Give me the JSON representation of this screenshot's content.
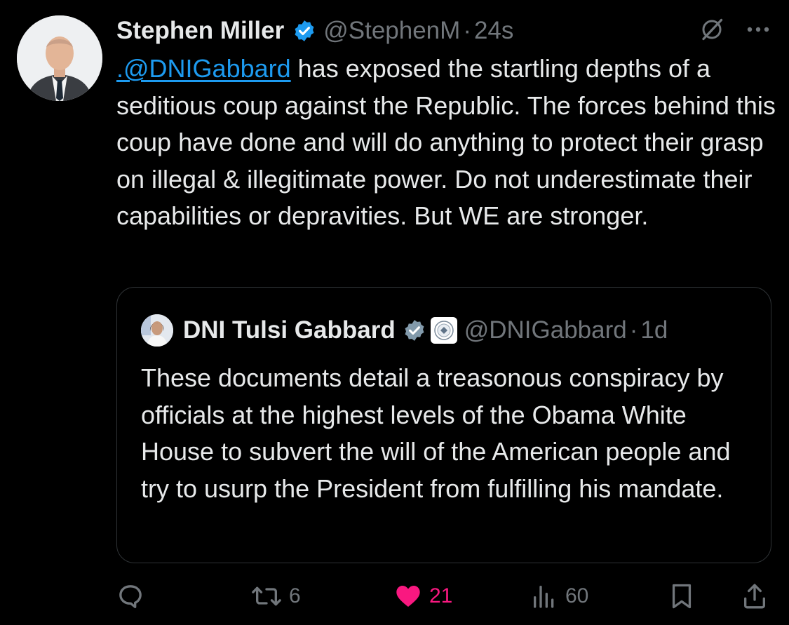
{
  "tweet": {
    "author_name": "Stephen Miller",
    "handle": "@StephenM",
    "separator": "·",
    "time": "24s",
    "mention": ".@DNIGabbard",
    "text": " has exposed the startling depths of a seditious coup against the Republic. The forces behind this coup have done and will do anything to protect their grasp on illegal & illegitimate power. Do not underestimate their capabilities or depravities. But WE are stronger."
  },
  "quoted_tweet": {
    "author_name": "DNI Tulsi Gabbard",
    "handle": "@DNIGabbard",
    "separator": "·",
    "time": "1d",
    "text": "These documents detail a treasonous conspiracy by officials at the highest levels of the Obama White House to subvert the will of the American people and try to usurp the President from fulfilling his mandate."
  },
  "actions": {
    "reply_count": "",
    "retweet_count": "6",
    "like_count": "21",
    "view_count": "60"
  },
  "icons": {
    "verified": "verified-badge-icon",
    "gov_verified": "gray-verified-badge-icon",
    "org_seal": "agency-seal-icon",
    "grok": "grok-icon",
    "more": "more-dots-icon",
    "reply": "reply-icon",
    "retweet": "retweet-icon",
    "like": "heart-icon",
    "views": "views-icon",
    "bookmark": "bookmark-icon",
    "share": "share-icon"
  },
  "colors": {
    "background": "#000000",
    "text": "#e7e9ea",
    "secondary": "#71767b",
    "link": "#1d9bf0",
    "like": "#f91880",
    "border": "#2f3336"
  }
}
